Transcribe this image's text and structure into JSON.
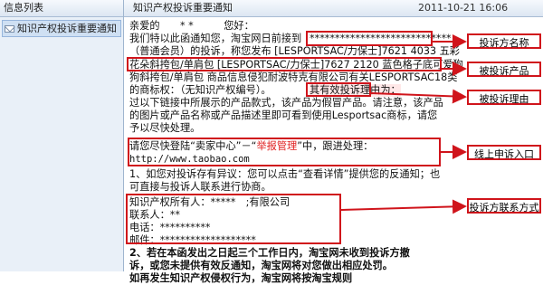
{
  "sidebar": {
    "header": "信息列表",
    "items": [
      {
        "label": "知识产权投诉重要通知"
      }
    ]
  },
  "mail": {
    "subject": "知识产权投诉重要通知",
    "date": "2011-10-21 16:06",
    "lines": [
      "亲爱的　　* *　　　您好：",
      "我们特以此函通知您，淘宝网日前接到",
      "（普通会员）的投诉，称您发布 [LESPORTSAC/力保士]7621 4033 五彩",
      "花朵斜挎包/单肩包 [LESPORTSAC/力保士]7627 2120 蓝色格子底可爱狗",
      "狗斜挎包/单肩包 商品信息侵犯耐波特克有限公司有关LESPORTSAC18类",
      "的商标权：（无知识产权编号）。",
      "其有效投诉理由为：",
      "过以下链接中所展示的产品款式，该产品为假冒产品。请注意，该产品",
      "的图片或产品名称或产品描述里即可看到使用Lesportsac商标，请您",
      "予以尽快处理。",
      "请您尽快登陆“卖家中心”－“",
      "举报管理",
      "”中，跟进处理：",
      "http://www.taobao.com",
      "1、如您对投诉存有异议：您可以点击“查看详情”提供您的反通知；也",
      "可直接与投诉人联系进行协商。",
      "知识产权所有人：*****　;有限公司",
      "联系人：**",
      "电话：**********",
      "邮件：*******************",
      "2、若在本函发出之日起三个工作日内，淘宝网未收到投诉方撤",
      "诉，或您未提供有效反通知，淘宝网将对您做出相应处罚。",
      "如再发生知识产权侵权行为，淘宝网将按淘宝规则"
    ],
    "complainant_name": "****************************",
    "reason": "假冒产品"
  },
  "callouts": {
    "complainant": "投诉方名称",
    "product": "被投诉产品",
    "reason": "被投诉理由",
    "online": "线上申诉入口",
    "contact": "投诉方联系方式"
  },
  "colors": {
    "annotation_red": "#d0141b",
    "highlight_red": "#e02020"
  }
}
